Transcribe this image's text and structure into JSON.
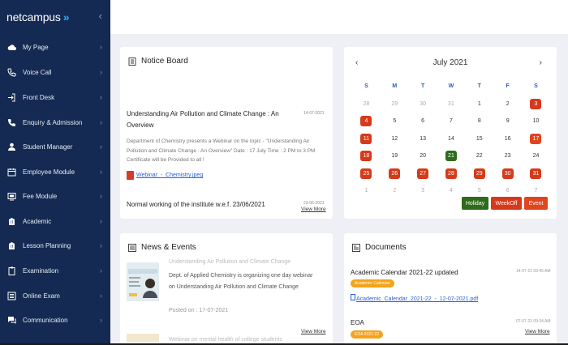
{
  "brand": {
    "logo_text": "netcampus",
    "logo_arrows": "»",
    "collapse_icon": "‹"
  },
  "sidebar": {
    "items": [
      {
        "label": "My Page",
        "icon": "cloud-icon"
      },
      {
        "label": "Voice Call",
        "icon": "phone-call-icon"
      },
      {
        "label": "Front Desk",
        "icon": "login-icon"
      },
      {
        "label": "Enquiry & Admission",
        "icon": "phone-icon"
      },
      {
        "label": "Student Manager",
        "icon": "user-icon"
      },
      {
        "label": "Employee Module",
        "icon": "calendar-icon"
      },
      {
        "label": "Fee Module",
        "icon": "fee-icon"
      },
      {
        "label": "Academic",
        "icon": "building-icon"
      },
      {
        "label": "Lesson Planning",
        "icon": "building-icon"
      },
      {
        "label": "Examination",
        "icon": "clipboard-icon"
      },
      {
        "label": "Online Exam",
        "icon": "list-icon"
      },
      {
        "label": "Communication",
        "icon": "chat-icon"
      }
    ],
    "chevron": "›"
  },
  "notice_board": {
    "title": "Notice Board",
    "items": [
      {
        "title": "Understanding Air Pollution and Climate Change : An Overview",
        "date": "14-07-2021",
        "body": "Department of Chemistry presents a Webinar on the topic - \"Understanding Air Pollution and Climate Change : An Overview\" Date : 17 July Time : 2 PM to 3 PM Certificate will be Provided to all !",
        "attachment": "Webinar_-_Chemistry.jpeg"
      },
      {
        "title": "Normal working of the institute w.e.f. 23/06/2021",
        "date": "23-06-2021",
        "view_more": "View More"
      }
    ]
  },
  "calendar": {
    "month": "July 2021",
    "prev": "‹",
    "next": "›",
    "weekdays": [
      "S",
      "M",
      "T",
      "W",
      "T",
      "F",
      "S"
    ],
    "weeks": [
      [
        {
          "d": "28",
          "t": "dim"
        },
        {
          "d": "29",
          "t": "dim"
        },
        {
          "d": "30",
          "t": "dim"
        },
        {
          "d": "31",
          "t": "dim"
        },
        {
          "d": "1",
          "t": ""
        },
        {
          "d": "2",
          "t": ""
        },
        {
          "d": "3",
          "t": "weekoff"
        }
      ],
      [
        {
          "d": "4",
          "t": "weekoff"
        },
        {
          "d": "5",
          "t": ""
        },
        {
          "d": "6",
          "t": ""
        },
        {
          "d": "7",
          "t": ""
        },
        {
          "d": "8",
          "t": ""
        },
        {
          "d": "9",
          "t": ""
        },
        {
          "d": "10",
          "t": ""
        }
      ],
      [
        {
          "d": "11",
          "t": "weekoff"
        },
        {
          "d": "12",
          "t": ""
        },
        {
          "d": "13",
          "t": ""
        },
        {
          "d": "14",
          "t": ""
        },
        {
          "d": "15",
          "t": ""
        },
        {
          "d": "16",
          "t": ""
        },
        {
          "d": "17",
          "t": "event"
        }
      ],
      [
        {
          "d": "18",
          "t": "weekoff"
        },
        {
          "d": "19",
          "t": ""
        },
        {
          "d": "20",
          "t": ""
        },
        {
          "d": "21",
          "t": "holiday"
        },
        {
          "d": "22",
          "t": ""
        },
        {
          "d": "23",
          "t": ""
        },
        {
          "d": "24",
          "t": ""
        }
      ],
      [
        {
          "d": "25",
          "t": "weekoff"
        },
        {
          "d": "26",
          "t": "weekoff"
        },
        {
          "d": "27",
          "t": "weekoff"
        },
        {
          "d": "28",
          "t": "weekoff"
        },
        {
          "d": "29",
          "t": "weekoff"
        },
        {
          "d": "30",
          "t": "weekoff"
        },
        {
          "d": "31",
          "t": "weekoff"
        }
      ],
      [
        {
          "d": "1",
          "t": "dim"
        },
        {
          "d": "2",
          "t": "dim"
        },
        {
          "d": "3",
          "t": "dim"
        },
        {
          "d": "4",
          "t": "dim"
        },
        {
          "d": "5",
          "t": "dim"
        },
        {
          "d": "6",
          "t": "dim"
        },
        {
          "d": "7",
          "t": "dim"
        }
      ]
    ],
    "legend": {
      "holiday": "Holiday",
      "weekoff": "WeekOff",
      "event": "Event"
    },
    "colors": {
      "holiday": "#2e6b1a",
      "weekoff": "#d63a1a",
      "event": "#e0451f"
    }
  },
  "news_events": {
    "title": "News & Events",
    "faded_top": "Understanding Air Pollution and Climate Change",
    "body": "Dept. of Applied Chemistry is organizing one day webinar on Understanding Air Pollution and Climate Change",
    "posted": "Posted on : 17-07-2021",
    "view_more": "View More",
    "faded_bottom": "Webinar on mental health of college students"
  },
  "documents": {
    "title": "Documents",
    "items": [
      {
        "title": "Academic Calendar 2021-22 updated",
        "badge": "Academic Calendar",
        "date": "14-07-21 09:45 AM",
        "link": "Academic_Calendar_2021-22_-_12-07-2021.pdf"
      },
      {
        "title": "EOA",
        "badge": "EOA 2021-22",
        "date": "07-07-21 09:34 AM",
        "view_more": "View More"
      }
    ]
  }
}
